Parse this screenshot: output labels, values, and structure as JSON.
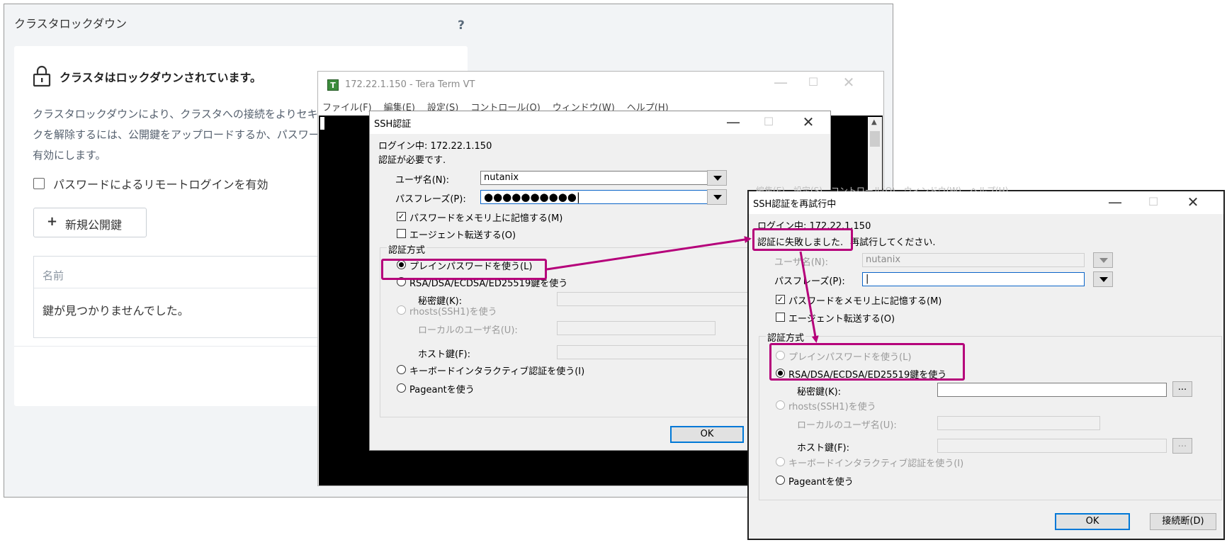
{
  "nutanix": {
    "title": "クラスタロックダウン",
    "help": "?",
    "heading": "クラスタはロックダウンされています。",
    "desc_lines": [
      "クラスタロックダウンにより、クラスタへの接続をよりセキュア",
      "クを解除するには、公開鍵をアップロードするか、パスワー",
      "有効にします。"
    ],
    "password_login_label": "パスワードによるリモートログインを有効",
    "new_key_button": "新規公開鍵",
    "table_header": "名前",
    "empty_message": "鍵が見つかりませんでした。"
  },
  "teraterm": {
    "title": "172.22.1.150 - Tera Term VT",
    "menu": [
      "ファイル(F)",
      "編集(E)",
      "設定(S)",
      "コントロール(O)",
      "ウィンドウ(W)",
      "ヘルプ(H)"
    ]
  },
  "ssh_auth": {
    "title": "SSH認証",
    "login_line": "ログイン中: 172.22.1.150",
    "auth_required": "認証が必要です.",
    "username_label": "ユーザ名(N):",
    "username_value": "nutanix",
    "passphrase_label": "パスフレーズ(P):",
    "passphrase_value": "●●●●●●●●●●|",
    "remember_label": "パスワードをメモリ上に記憶する(M)",
    "agent_label": "エージェント転送する(O)",
    "method_label": "認証方式",
    "plain_label": "プレインパスワードを使う(L)",
    "rsa_label": "RSA/DSA/ECDSA/ED25519鍵を使う",
    "private_key_label": "秘密鍵(K):",
    "rhosts_label": "rhosts(SSH1)を使う",
    "local_user_label": "ローカルのユーザ名(U):",
    "host_key_label": "ホスト鍵(F):",
    "keyboard_label": "キーボードインタラクティブ認証を使う(I)",
    "pageant_label": "Pageantを使う",
    "ok": "OK"
  },
  "ssh_retry": {
    "title": "SSH認証を再試行中",
    "ghost_menu": "編集(E)　設定(S)　コントロール(O)　ウィンドウ(W)　ヘルプ(H)",
    "login_line": "ログイン中: 172.22.1.150",
    "fail_part": "認証に失敗しました.",
    "retry_part": "再試行してください.",
    "username_label": "ユーザ名(N):",
    "username_value": "nutanix",
    "passphrase_label": "パスフレーズ(P):",
    "passphrase_value": "|",
    "remember_label": "パスワードをメモリ上に記憶する(M)",
    "agent_label": "エージェント転送する(O)",
    "method_label": "認証方式",
    "plain_label": "プレインパスワードを使う(L)",
    "rsa_label": "RSA/DSA/ECDSA/ED25519鍵を使う",
    "private_key_label": "秘密鍵(K):",
    "browse": "...",
    "rhosts_label": "rhosts(SSH1)を使う",
    "local_user_label": "ローカルのユーザ名(U):",
    "host_key_label": "ホスト鍵(F):",
    "keyboard_label": "キーボードインタラクティブ認証を使う(I)",
    "pageant_label": "Pageantを使う",
    "ok": "OK",
    "disconnect": "接続断(D)"
  },
  "colors": {
    "highlight": "#b5007a",
    "accent": "#0078d7"
  },
  "icons": [
    "lock-icon",
    "teraterm-icon",
    "checkbox-icon",
    "plus-icon",
    "arrow-icon"
  ]
}
